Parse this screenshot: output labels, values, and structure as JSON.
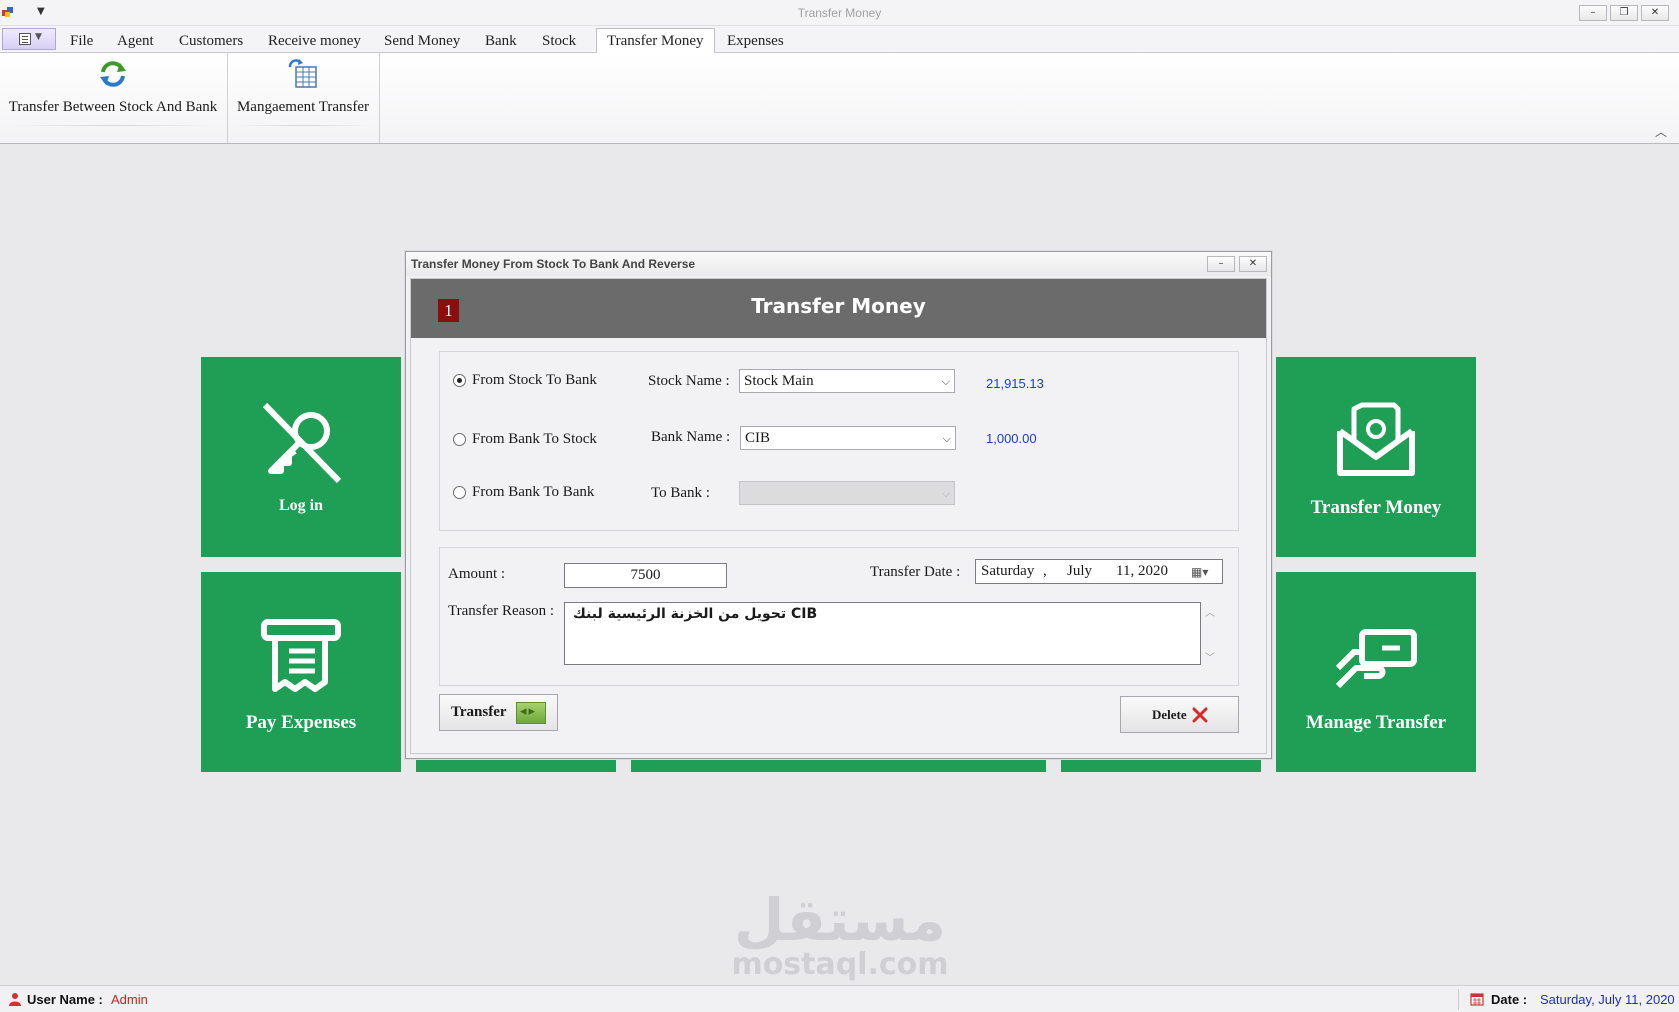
{
  "window": {
    "title": "Transfer Money"
  },
  "menu": {
    "tabs": [
      {
        "label": "File"
      },
      {
        "label": "Agent"
      },
      {
        "label": "Customers"
      },
      {
        "label": "Receive money"
      },
      {
        "label": "Send Money"
      },
      {
        "label": "Bank"
      },
      {
        "label": "Stock"
      },
      {
        "label": "Transfer Money",
        "active": true
      },
      {
        "label": "Expenses"
      }
    ]
  },
  "ribbon": {
    "buttons": [
      {
        "label": "Transfer Between Stock And Bank",
        "icon": "refresh-arrows-icon"
      },
      {
        "label": "Mangaement Transfer",
        "icon": "table-transfer-icon"
      }
    ]
  },
  "tiles": {
    "login": "Log in",
    "pay_expenses": "Pay Expenses",
    "transfer_money": "Transfer Money",
    "manage_transfer": "Manage Transfer"
  },
  "dialog": {
    "window_title": "Transfer Money From Stock To Bank And Reverse",
    "step_number": "1",
    "header_title": "Transfer Money",
    "radios": [
      {
        "label": "From Stock To Bank",
        "checked": true
      },
      {
        "label": "From Bank To Stock",
        "checked": false
      },
      {
        "label": "From Bank To Bank",
        "checked": false
      }
    ],
    "stock_name": {
      "label": "Stock Name :",
      "value": "Stock Main",
      "balance": "21,915.13"
    },
    "bank_name": {
      "label": "Bank Name :",
      "value": "CIB",
      "balance": "1,000.00"
    },
    "to_bank": {
      "label": "To Bank  :",
      "value": ""
    },
    "amount": {
      "label": "Amount :",
      "value": "7500"
    },
    "transfer_date": {
      "label": "Transfer Date :",
      "weekday": "Saturday",
      "sep": ",",
      "month": "July",
      "day_year": "11, 2020"
    },
    "transfer_reason": {
      "label": "Transfer Reason :",
      "value": "تحويل من الخزنة الرئيسية لبنك CIB"
    },
    "transfer_button": "Transfer",
    "delete_button": "Delete"
  },
  "watermark": {
    "arabic": "مستقل",
    "latin": "mostaql.com"
  },
  "status": {
    "user_label": "User Name :",
    "user_value": "Admin",
    "date_label": "Date :",
    "date_value": "Saturday, July 11, 2020"
  },
  "colors": {
    "tile_green": "#1f9e56",
    "header_gray": "#6b6b6b",
    "balance_blue": "#1c3ec4",
    "step_red": "#8b0e0e"
  }
}
